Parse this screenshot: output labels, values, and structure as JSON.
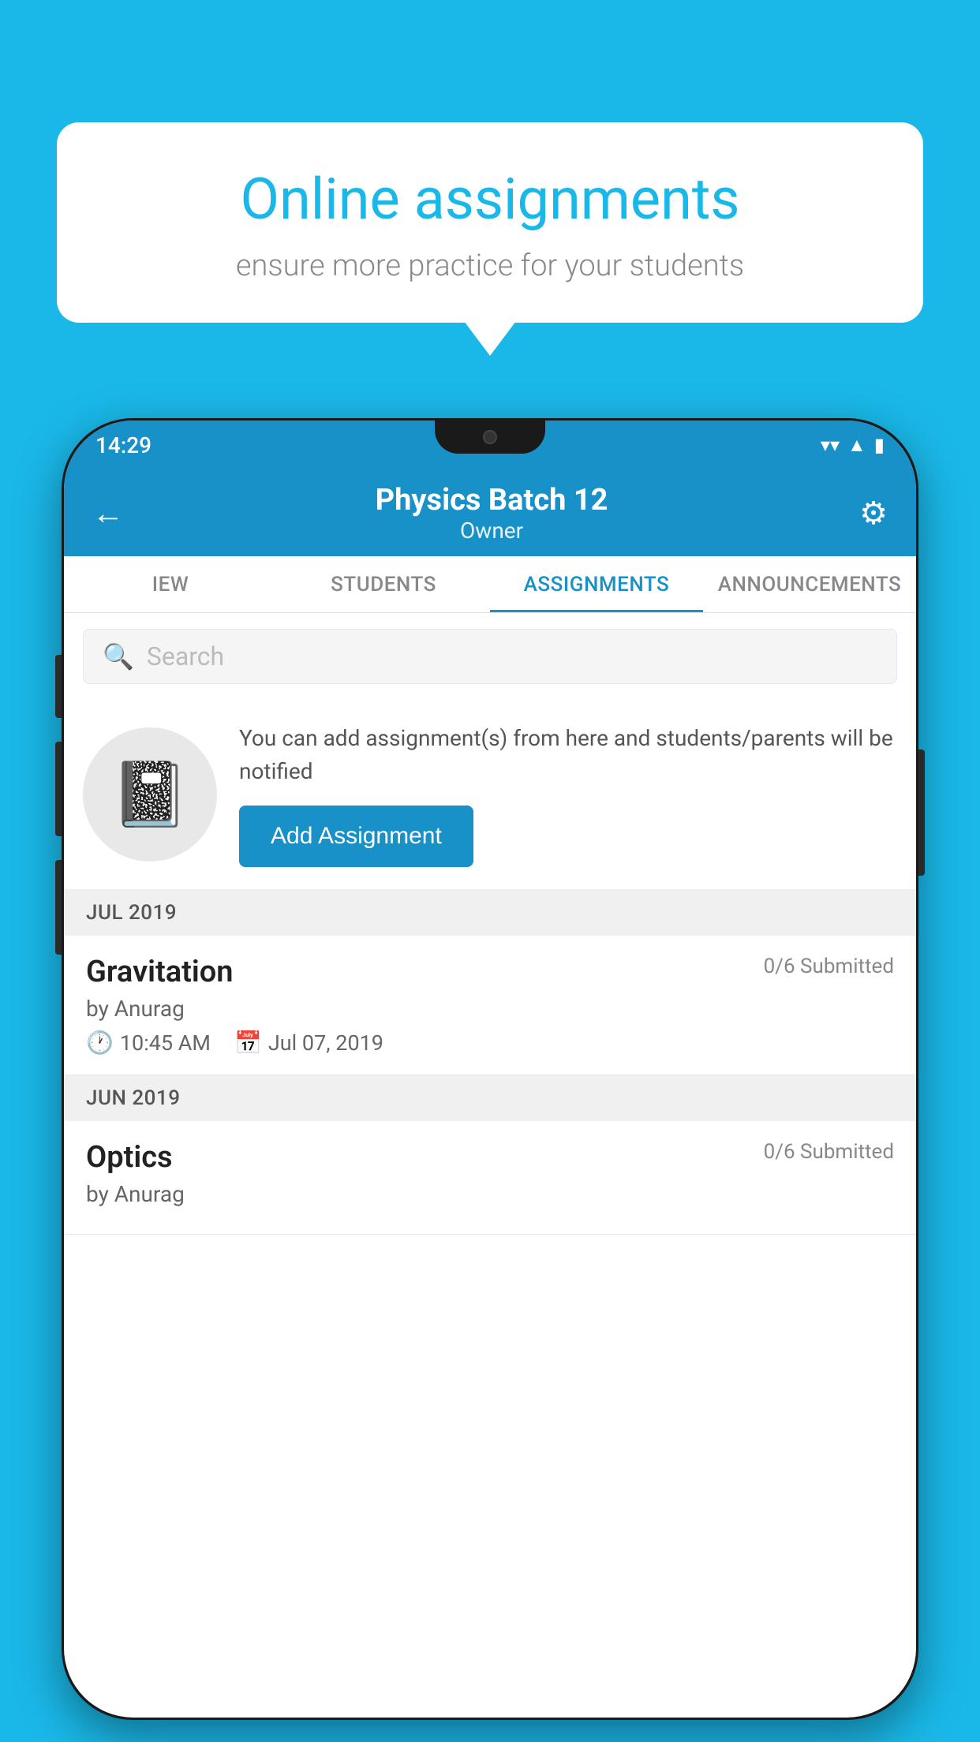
{
  "background_color": "#1ab8e8",
  "speech_bubble": {
    "title": "Online assignments",
    "subtitle": "ensure more practice for your students"
  },
  "status_bar": {
    "time": "14:29",
    "icons": [
      "wifi",
      "signal",
      "battery"
    ]
  },
  "app_header": {
    "title": "Physics Batch 12",
    "subtitle": "Owner",
    "back_label": "←",
    "settings_label": "⚙"
  },
  "tabs": [
    {
      "label": "IEW",
      "active": false
    },
    {
      "label": "STUDENTS",
      "active": false
    },
    {
      "label": "ASSIGNMENTS",
      "active": true
    },
    {
      "label": "ANNOUNCEMENTS",
      "active": false
    }
  ],
  "search": {
    "placeholder": "Search"
  },
  "add_assignment": {
    "description": "You can add assignment(s) from here and students/parents will be notified",
    "button_label": "Add Assignment"
  },
  "months": [
    {
      "label": "JUL 2019",
      "assignments": [
        {
          "name": "Gravitation",
          "submitted": "0/6 Submitted",
          "by": "by Anurag",
          "time": "10:45 AM",
          "date": "Jul 07, 2019"
        }
      ]
    },
    {
      "label": "JUN 2019",
      "assignments": [
        {
          "name": "Optics",
          "submitted": "0/6 Submitted",
          "by": "by Anurag",
          "time": "",
          "date": ""
        }
      ]
    }
  ]
}
